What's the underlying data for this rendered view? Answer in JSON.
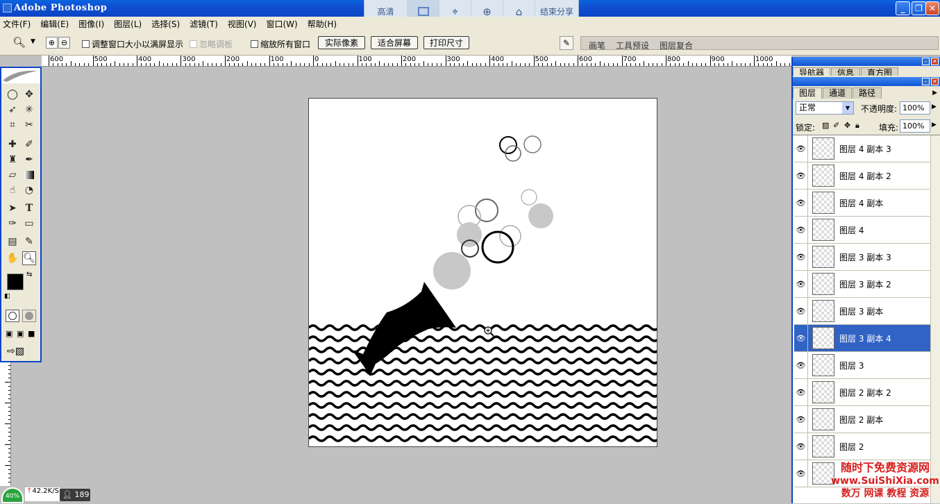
{
  "window": {
    "title": "Adobe Photoshop"
  },
  "share_bar": {
    "hd": "高清",
    "end_share": "结束分享"
  },
  "menu": [
    "文件(F)",
    "编辑(E)",
    "图像(I)",
    "图层(L)",
    "选择(S)",
    "滤镜(T)",
    "视图(V)",
    "窗口(W)",
    "帮助(H)"
  ],
  "options": {
    "resize_window": "调整窗口大小以满屏显示",
    "ignore_palettes": "忽略调板",
    "zoom_all": "缩放所有窗口",
    "actual_pixels": "实际像素",
    "fit_screen": "适合屏幕",
    "print_size": "打印尺寸"
  },
  "palette_tabs": [
    "画笔",
    "工具预设",
    "图层复合"
  ],
  "ruler_labels": [
    "600",
    "500",
    "400",
    "300",
    "200",
    "100",
    "0",
    "100",
    "200",
    "300",
    "400",
    "500",
    "600",
    "700",
    "800",
    "900",
    "1000"
  ],
  "navigator_tabs": [
    "导航器",
    "信息",
    "直方图"
  ],
  "layers_panel": {
    "tabs": [
      "图层",
      "通道",
      "路径"
    ],
    "blend_mode": "正常",
    "opacity_label": "不透明度:",
    "opacity": "100%",
    "lock_label": "锁定:",
    "fill_label": "填充:",
    "fill": "100%",
    "layers": [
      {
        "name": "图层 4 副本 3",
        "selected": false
      },
      {
        "name": "图层 4 副本 2",
        "selected": false
      },
      {
        "name": "图层 4 副本",
        "selected": false
      },
      {
        "name": "图层 4",
        "selected": false
      },
      {
        "name": "图层 3 副本 3",
        "selected": false
      },
      {
        "name": "图层 3 副本 2",
        "selected": false
      },
      {
        "name": "图层 3 副本",
        "selected": false
      },
      {
        "name": "图层 3 副本 4",
        "selected": true
      },
      {
        "name": "图层 3",
        "selected": false
      },
      {
        "name": "图层 2 副本 2",
        "selected": false
      },
      {
        "name": "图层 2 副本",
        "selected": false
      },
      {
        "name": "图层 2",
        "selected": false
      },
      {
        "name": "",
        "selected": false
      }
    ]
  },
  "status": {
    "zoom": "40%",
    "speed": "42.2K/S",
    "count": "189"
  },
  "watermark": {
    "line1": "随时下免费资源网",
    "line2": "www.SuiShiXia.com",
    "line3": "数万 网课 教程 资源"
  },
  "colors": {
    "title_blue": "#0b45c4",
    "selection_blue": "#3163c5",
    "ui_gray": "#ece9d8",
    "workspace": "#c0c0c0"
  }
}
